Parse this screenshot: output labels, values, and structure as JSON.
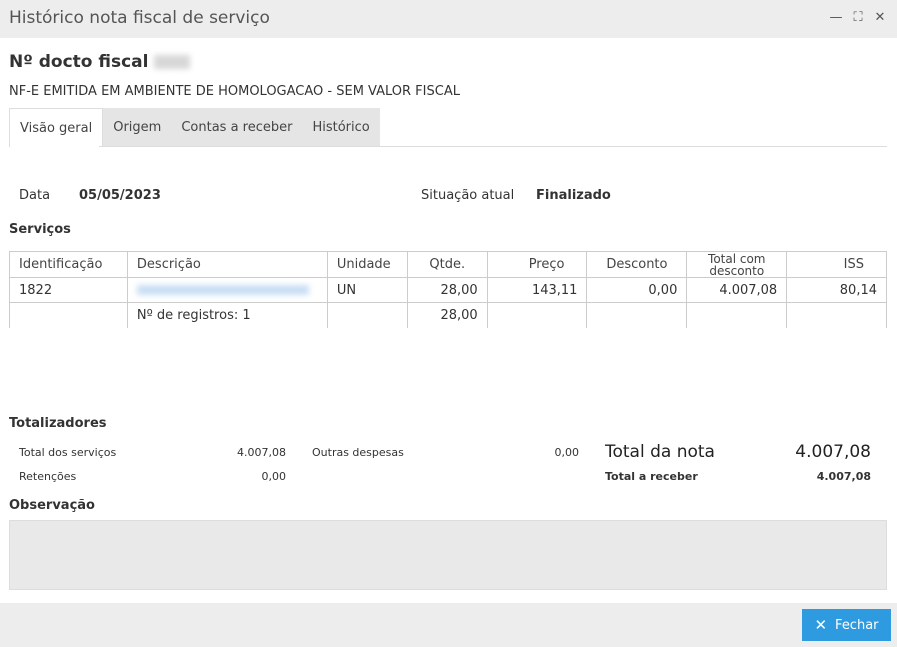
{
  "window": {
    "title": "Histórico nota fiscal de serviço",
    "controls": [
      "minimize-icon",
      "maximize-icon",
      "close-icon"
    ]
  },
  "document": {
    "title": "Nº docto fiscal",
    "subtitle": "NF-E EMITIDA EM AMBIENTE DE HOMOLOGACAO - SEM VALOR FISCAL"
  },
  "tabs": [
    {
      "label": "Visão geral",
      "active": true
    },
    {
      "label": "Origem",
      "active": false
    },
    {
      "label": "Contas a receber",
      "active": false
    },
    {
      "label": "Histórico",
      "active": false
    }
  ],
  "overview": {
    "date_label": "Data",
    "date_value": "05/05/2023",
    "status_label": "Situação atual",
    "status_value": "Finalizado"
  },
  "services": {
    "title": "Serviços",
    "columns": [
      "Identificação",
      "Descrição",
      "Unidade",
      "Qtde.",
      "Preço",
      "Desconto",
      "Total com desconto",
      "ISS"
    ],
    "rows": [
      {
        "id": "1822",
        "unit": "UN",
        "qty": "28,00",
        "price": "143,11",
        "discount": "0,00",
        "total": "4.007,08",
        "iss": "80,14"
      }
    ],
    "summary": {
      "records": "Nº de registros: 1",
      "qty_total": "28,00"
    }
  },
  "totals": {
    "title": "Totalizadores",
    "services_label": "Total dos serviços",
    "services_value": "4.007,08",
    "other_label": "Outras despesas",
    "other_value": "0,00",
    "retentions_label": "Retenções",
    "retentions_value": "0,00",
    "invoice_label": "Total da nota",
    "invoice_value": "4.007,08",
    "receivable_label": "Total a receber",
    "receivable_value": "4.007,08"
  },
  "observation": {
    "title": "Observação"
  },
  "footer": {
    "close_label": "Fechar"
  }
}
